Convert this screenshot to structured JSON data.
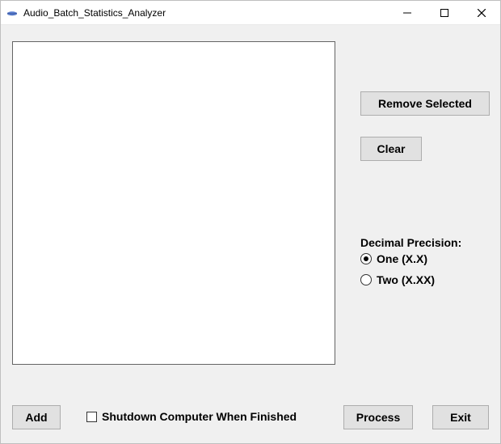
{
  "window": {
    "title": "Audio_Batch_Statistics_Analyzer"
  },
  "buttons": {
    "remove_selected": "Remove Selected",
    "clear": "Clear",
    "add": "Add",
    "process": "Process",
    "exit": "Exit"
  },
  "precision": {
    "label": "Decimal Precision:",
    "options": {
      "one": "One (X.X)",
      "two": "Two (X.XX)"
    },
    "selected": "one"
  },
  "shutdown": {
    "label": "Shutdown Computer When Finished",
    "checked": false
  },
  "list": {
    "items": []
  }
}
